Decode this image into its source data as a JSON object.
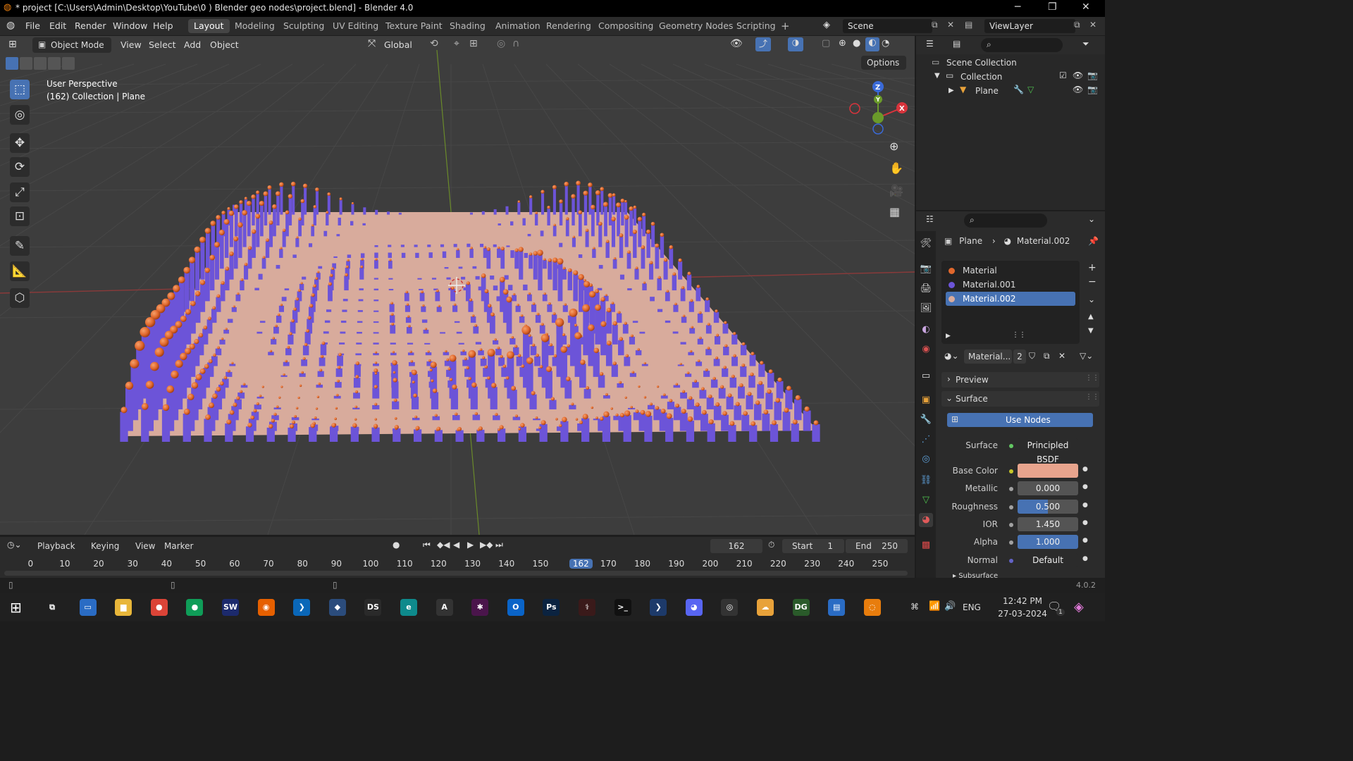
{
  "window": {
    "title": "* project [C:\\Users\\Admin\\Desktop\\YouTube\\0 ) Blender geo nodes\\project.blend] - Blender 4.0",
    "controls": [
      "─",
      "❐",
      "✕"
    ]
  },
  "menubar": {
    "menus": [
      "File",
      "Edit",
      "Render",
      "Window",
      "Help"
    ],
    "workspaces": [
      "Layout",
      "Modeling",
      "Sculpting",
      "UV Editing",
      "Texture Paint",
      "Shading",
      "Animation",
      "Rendering",
      "Compositing",
      "Geometry Nodes",
      "Scripting"
    ],
    "active_workspace": "Layout",
    "add_tab": "+",
    "scene": "Scene",
    "view_layer": "ViewLayer"
  },
  "viewport": {
    "mode": "Object Mode",
    "menus": [
      "View",
      "Select",
      "Add",
      "Object"
    ],
    "transform_orientation": "Global",
    "options": "Options",
    "overlay_title": "User Perspective",
    "overlay_subtitle": "(162) Collection | Plane",
    "gizmo": {
      "x": "X",
      "y": "Y",
      "z": "Z"
    },
    "colors": {
      "background": "#3d3d3d",
      "plane": "#d8ab9c",
      "bars": "#6c54d8",
      "spheres": "#e0672c",
      "x_axis": "#8a3a3a",
      "y_axis": "#6a8a2a"
    }
  },
  "outliner": {
    "scene_collection": "Scene Collection",
    "collection": "Collection",
    "object": "Plane"
  },
  "properties": {
    "breadcrumb_object": "Plane",
    "breadcrumb_material": "Material.002",
    "material_slots": [
      {
        "name": "Material",
        "color": "#e0672c"
      },
      {
        "name": "Material.001",
        "color": "#6c54d8"
      },
      {
        "name": "Material.002",
        "color": "#d8ab9c"
      }
    ],
    "selected_slot": "Material.002",
    "material_field": "Material...",
    "user_count": "2",
    "panels": {
      "preview": "Preview",
      "surface": "Surface",
      "subsurface": "Subsurface"
    },
    "use_nodes": "Use Nodes",
    "rows": [
      {
        "label": "Surface",
        "value": "Principled BSDF",
        "style": "text"
      },
      {
        "label": "Base Color",
        "value": "",
        "style": "color"
      },
      {
        "label": "Metallic",
        "value": "0.000",
        "style": "slider",
        "fill": 0.0
      },
      {
        "label": "Roughness",
        "value": "0.500",
        "style": "slider",
        "fill": 0.5
      },
      {
        "label": "IOR",
        "value": "1.450",
        "style": "slider",
        "fill": 0.0
      },
      {
        "label": "Alpha",
        "value": "1.000",
        "style": "slider",
        "fill": 1.0
      },
      {
        "label": "Normal",
        "value": "Default",
        "style": "text"
      }
    ],
    "base_color": "#e8a48d"
  },
  "timeline": {
    "menus": [
      "Playback",
      "Keying",
      "View",
      "Marker"
    ],
    "current_frame": "162",
    "start_label": "Start",
    "start": "1",
    "end_label": "End",
    "end": "250",
    "ruler": [
      "0",
      "10",
      "20",
      "30",
      "40",
      "50",
      "60",
      "70",
      "80",
      "90",
      "100",
      "110",
      "120",
      "130",
      "140",
      "150",
      "162",
      "170",
      "180",
      "190",
      "200",
      "210",
      "220",
      "230",
      "240",
      "250"
    ]
  },
  "statusbar": {
    "version": "4.0.2"
  },
  "taskbar": {
    "apps": [
      {
        "name": "task-view",
        "glyph": "⧉",
        "color": "#202020"
      },
      {
        "name": "desktop",
        "glyph": "▭",
        "color": "#2a6cc4"
      },
      {
        "name": "file-explorer",
        "glyph": "▆",
        "color": "#e8b63a"
      },
      {
        "name": "chrome-1",
        "glyph": "●",
        "color": "#db4437"
      },
      {
        "name": "chrome-2",
        "glyph": "●",
        "color": "#0f9d58"
      },
      {
        "name": "solidworks",
        "glyph": "SW",
        "color": "#1c2a6c"
      },
      {
        "name": "firefox",
        "glyph": "◉",
        "color": "#e66000"
      },
      {
        "name": "vscode",
        "glyph": "❯",
        "color": "#0a67b8"
      },
      {
        "name": "app-blue",
        "glyph": "◆",
        "color": "#2b4c7c"
      },
      {
        "name": "daz-studio",
        "glyph": "DS",
        "color": "#2a2a2a"
      },
      {
        "name": "edge",
        "glyph": "e",
        "color": "#0e8a8c"
      },
      {
        "name": "app-ac",
        "glyph": "A",
        "color": "#333"
      },
      {
        "name": "slack",
        "glyph": "✱",
        "color": "#4a154b"
      },
      {
        "name": "outlook",
        "glyph": "O",
        "color": "#0a64c8"
      },
      {
        "name": "photoshop",
        "glyph": "Ps",
        "color": "#0b2340"
      },
      {
        "name": "app-red",
        "glyph": "⚕",
        "color": "#3a1a1a"
      },
      {
        "name": "terminal",
        "glyph": ">_",
        "color": "#111"
      },
      {
        "name": "powershell",
        "glyph": "❯",
        "color": "#1d3a6a"
      },
      {
        "name": "discord",
        "glyph": "◕",
        "color": "#5865f2"
      },
      {
        "name": "obs",
        "glyph": "◎",
        "color": "#333"
      },
      {
        "name": "app-yellow",
        "glyph": "☁",
        "color": "#e8a23a"
      },
      {
        "name": "app-dg",
        "glyph": "DG",
        "color": "#2a5a2a"
      },
      {
        "name": "app-doc",
        "glyph": "▤",
        "color": "#2a6cc4"
      },
      {
        "name": "blender",
        "glyph": "◌",
        "color": "#e87d0d"
      }
    ],
    "tray": {
      "lang": "ENG",
      "time": "12:42 PM",
      "date": "27-03-2024",
      "notifications": "1"
    }
  }
}
